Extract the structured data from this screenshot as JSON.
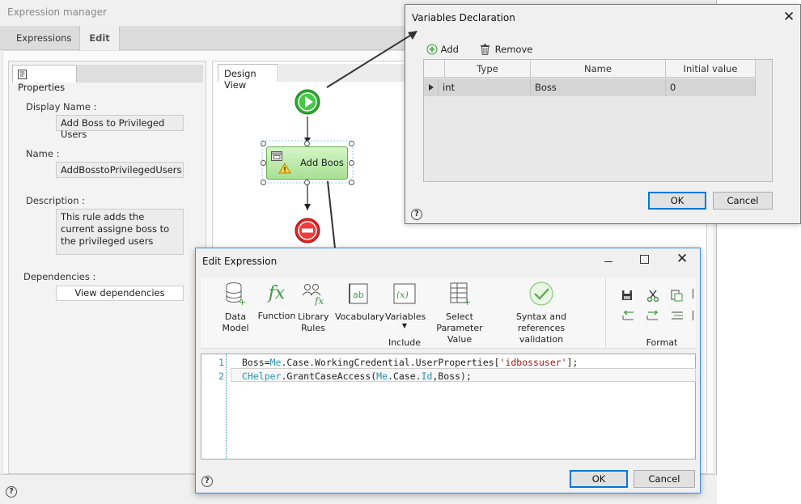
{
  "expression_manager": {
    "title": "Expression manager",
    "tabs": [
      "Expressions",
      "Edit"
    ]
  },
  "properties": {
    "tab_label": "Properties",
    "display_name_label": "Display Name :",
    "display_name_value": "Add Boss to Privileged Users",
    "name_label": "Name :",
    "name_value": "AddBosstoPrivilegedUsers",
    "description_label": "Description :",
    "description_value": "This rule adds the current assigne boss to the privileged users",
    "dependencies_label": "Dependencies :",
    "view_dependencies_button": "View dependencies"
  },
  "design_view": {
    "tab_label": "Design View",
    "node_label": "Add Boos"
  },
  "variables_dialog": {
    "title": "Variables Declaration",
    "add_label": "Add",
    "remove_label": "Remove",
    "columns": [
      "Type",
      "Name",
      "Initial value"
    ],
    "rows": [
      {
        "type": "int",
        "name": "Boss",
        "initial_value": "0"
      }
    ],
    "ok_label": "OK",
    "cancel_label": "Cancel",
    "help_glyph": "?"
  },
  "edit_expression": {
    "title": "Edit Expression",
    "ribbon": {
      "data_model": "Data Model",
      "function": "Function",
      "library_rules": "Library Rules",
      "vocabulary": "Vocabulary",
      "variables": "Variables",
      "select_parameter_value": "Select Parameter Value",
      "syntax_validation": "Syntax and references validation",
      "include_group": "Include",
      "format_group": "Format"
    },
    "code_lines": [
      {
        "number": "1",
        "text": "Boss=Me.Case.WorkingCredential.UserProperties['idbossuser'];"
      },
      {
        "number": "2",
        "text": "CHelper.GrantCaseAccess(Me.Case.Id,Boss);"
      }
    ],
    "ok_label": "OK",
    "cancel_label": "Cancel",
    "help_glyph": "?"
  },
  "colors": {
    "accent_blue": "#0078d7",
    "start_green": "#2eaa2e",
    "stop_red": "#e02424",
    "task_green": "#b6e8a4",
    "code_keyword": "#2b91af",
    "code_string": "#a31515"
  }
}
